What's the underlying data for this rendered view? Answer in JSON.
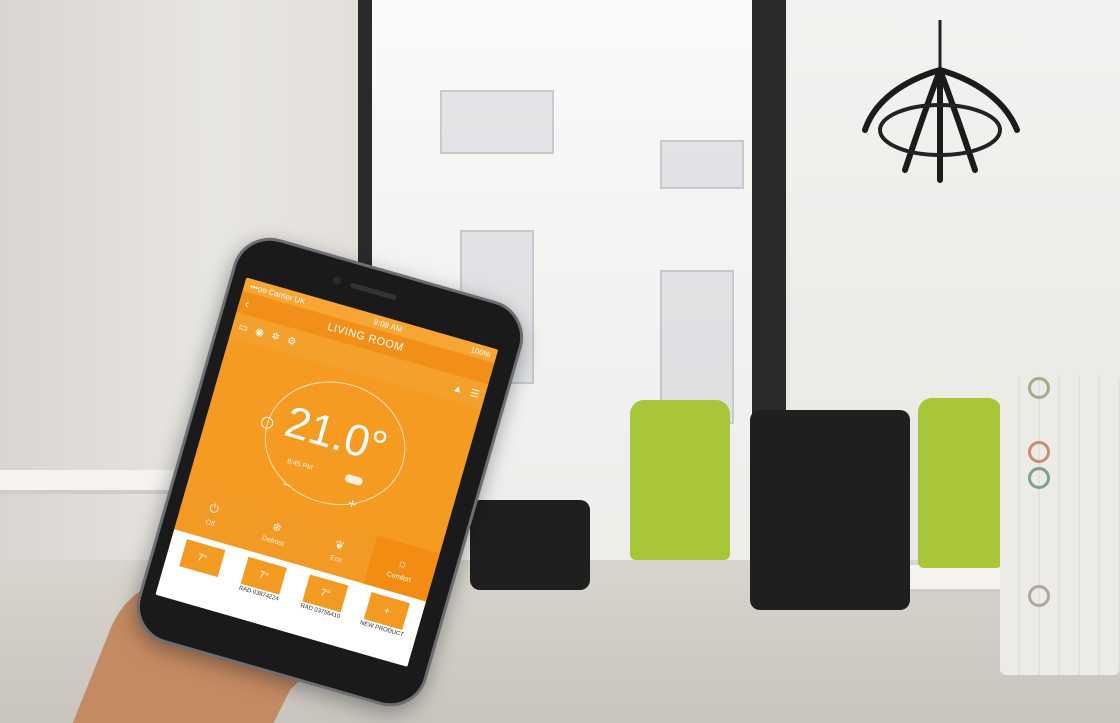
{
  "status_bar": {
    "carrier": "•••oo Carrier UK",
    "time": "8:08 AM",
    "battery": "100%"
  },
  "app": {
    "title": "LIVING ROOM",
    "back_icon": "chevron-left-icon"
  },
  "thermostat": {
    "temperature": "21.0°",
    "schedule_time": "8:45 PM",
    "minus": "−",
    "plus": "+"
  },
  "modes": [
    {
      "label": "Off",
      "icon": "power-icon"
    },
    {
      "label": "Defrost",
      "icon": "snowflake-icon"
    },
    {
      "label": "Eco",
      "icon": "leaf-icon"
    },
    {
      "label": "Comfort",
      "icon": "sun-icon"
    }
  ],
  "devices": [
    {
      "value": "7°",
      "label": ""
    },
    {
      "value": "7°",
      "label": "RAD 03874224"
    },
    {
      "value": "7°",
      "label": "RAD 03756410"
    },
    {
      "value": "+",
      "label": "NEW PRODUCT"
    }
  ],
  "colors": {
    "accent": "#f59b21",
    "chair_green": "#a9c63a"
  }
}
